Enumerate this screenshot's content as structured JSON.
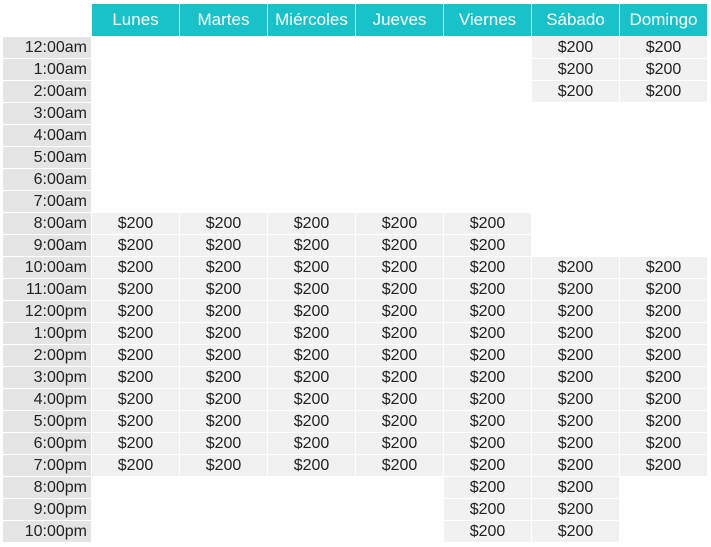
{
  "schedule": {
    "days": [
      "Lunes",
      "Martes",
      "Miércoles",
      "Jueves",
      "Viernes",
      "Sábado",
      "Domingo"
    ],
    "rows": [
      {
        "time": "12:00am",
        "cells": [
          "",
          "",
          "",
          "",
          "",
          "$200",
          "$200"
        ]
      },
      {
        "time": "1:00am",
        "cells": [
          "",
          "",
          "",
          "",
          "",
          "$200",
          "$200"
        ]
      },
      {
        "time": "2:00am",
        "cells": [
          "",
          "",
          "",
          "",
          "",
          "$200",
          "$200"
        ]
      },
      {
        "time": "3:00am",
        "cells": [
          "",
          "",
          "",
          "",
          "",
          "",
          ""
        ]
      },
      {
        "time": "4:00am",
        "cells": [
          "",
          "",
          "",
          "",
          "",
          "",
          ""
        ]
      },
      {
        "time": "5:00am",
        "cells": [
          "",
          "",
          "",
          "",
          "",
          "",
          ""
        ]
      },
      {
        "time": "6:00am",
        "cells": [
          "",
          "",
          "",
          "",
          "",
          "",
          ""
        ]
      },
      {
        "time": "7:00am",
        "cells": [
          "",
          "",
          "",
          "",
          "",
          "",
          ""
        ]
      },
      {
        "time": "8:00am",
        "cells": [
          "$200",
          "$200",
          "$200",
          "$200",
          "$200",
          "",
          ""
        ]
      },
      {
        "time": "9:00am",
        "cells": [
          "$200",
          "$200",
          "$200",
          "$200",
          "$200",
          "",
          ""
        ]
      },
      {
        "time": "10:00am",
        "cells": [
          "$200",
          "$200",
          "$200",
          "$200",
          "$200",
          "$200",
          "$200"
        ]
      },
      {
        "time": "11:00am",
        "cells": [
          "$200",
          "$200",
          "$200",
          "$200",
          "$200",
          "$200",
          "$200"
        ]
      },
      {
        "time": "12:00pm",
        "cells": [
          "$200",
          "$200",
          "$200",
          "$200",
          "$200",
          "$200",
          "$200"
        ]
      },
      {
        "time": "1:00pm",
        "cells": [
          "$200",
          "$200",
          "$200",
          "$200",
          "$200",
          "$200",
          "$200"
        ]
      },
      {
        "time": "2:00pm",
        "cells": [
          "$200",
          "$200",
          "$200",
          "$200",
          "$200",
          "$200",
          "$200"
        ]
      },
      {
        "time": "3:00pm",
        "cells": [
          "$200",
          "$200",
          "$200",
          "$200",
          "$200",
          "$200",
          "$200"
        ]
      },
      {
        "time": "4:00pm",
        "cells": [
          "$200",
          "$200",
          "$200",
          "$200",
          "$200",
          "$200",
          "$200"
        ]
      },
      {
        "time": "5:00pm",
        "cells": [
          "$200",
          "$200",
          "$200",
          "$200",
          "$200",
          "$200",
          "$200"
        ]
      },
      {
        "time": "6:00pm",
        "cells": [
          "$200",
          "$200",
          "$200",
          "$200",
          "$200",
          "$200",
          "$200"
        ]
      },
      {
        "time": "7:00pm",
        "cells": [
          "$200",
          "$200",
          "$200",
          "$200",
          "$200",
          "$200",
          "$200"
        ]
      },
      {
        "time": "8:00pm",
        "cells": [
          "",
          "",
          "",
          "",
          "$200",
          "$200",
          ""
        ]
      },
      {
        "time": "9:00pm",
        "cells": [
          "",
          "",
          "",
          "",
          "$200",
          "$200",
          ""
        ]
      },
      {
        "time": "10:00pm",
        "cells": [
          "",
          "",
          "",
          "",
          "$200",
          "$200",
          ""
        ]
      }
    ]
  },
  "colors": {
    "header_bg": "#19c2c8",
    "header_text": "#ffffff",
    "time_label_bg": "#e4e4e4",
    "filled_cell_bg": "#f1f1f1"
  }
}
